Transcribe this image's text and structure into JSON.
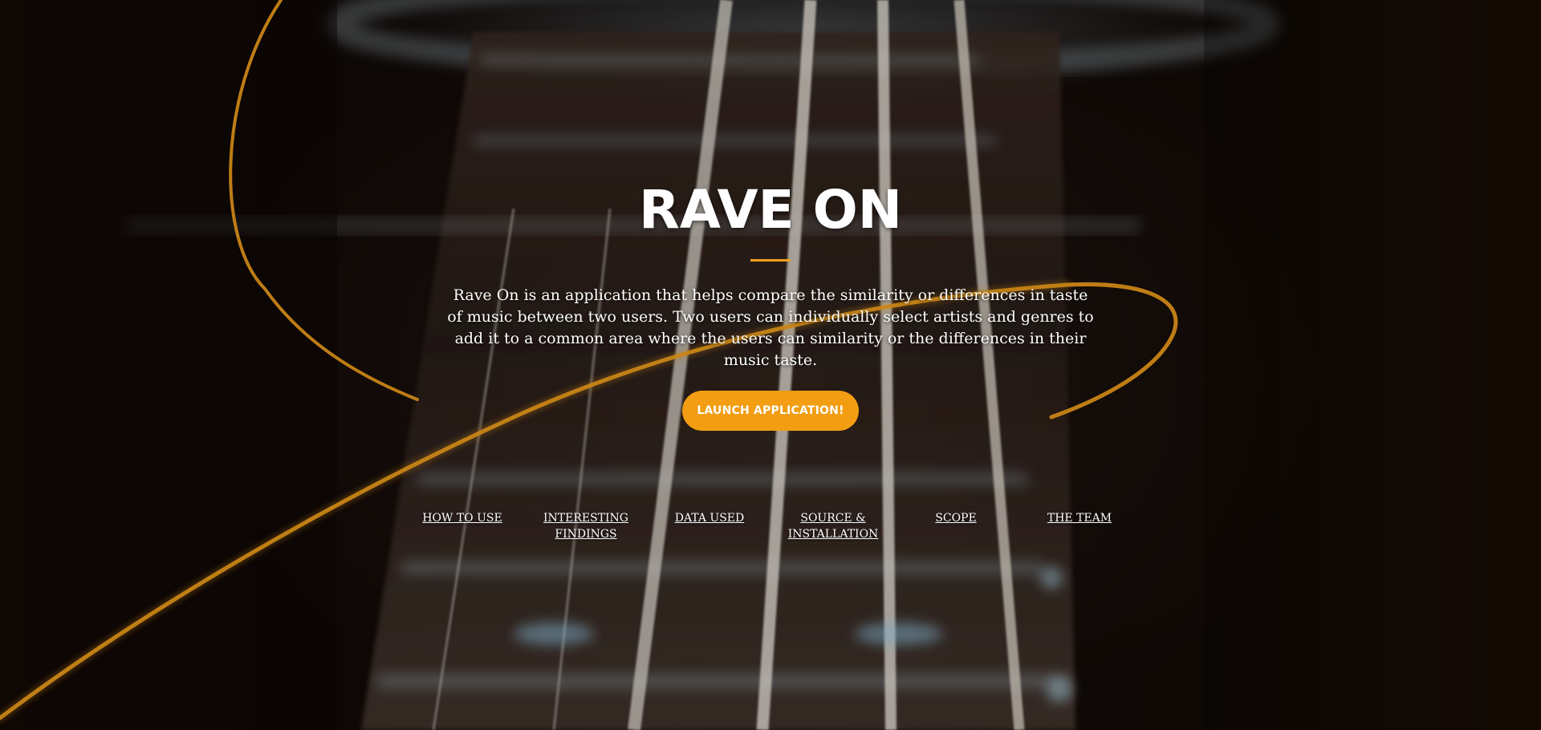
{
  "hero": {
    "title": "RAVE ON",
    "description": "Rave On is an application that helps compare the similarity or differences in taste of music between two users. Two users can individually select artists and genres to add it to a common area where the users can similarity or the differences in their music taste.",
    "launch_button_label": "LAUNCH APPLICATION!",
    "accent_color": "#f29d12"
  },
  "nav": {
    "items": [
      {
        "label_lines": [
          "HOW TO USE"
        ]
      },
      {
        "label_lines": [
          "INTERESTING",
          "FINDINGS"
        ]
      },
      {
        "label_lines": [
          "DATA USED"
        ]
      },
      {
        "label_lines": [
          "SOURCE &",
          "INSTALLATION"
        ]
      },
      {
        "label_lines": [
          "SCOPE"
        ]
      },
      {
        "label_lines": [
          "THE TEAM"
        ]
      }
    ]
  }
}
